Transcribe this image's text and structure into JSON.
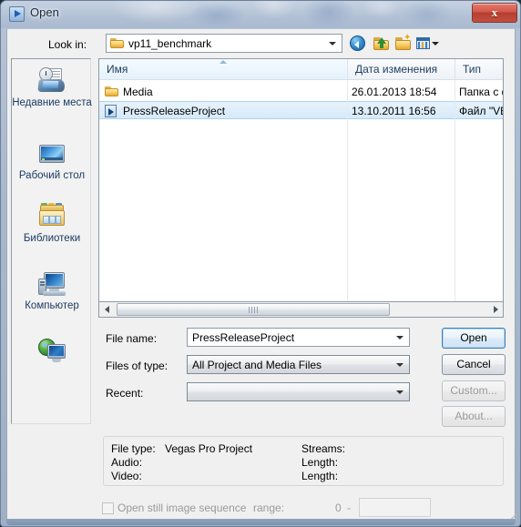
{
  "window": {
    "title": "Open",
    "title_icon": "vegas-play-icon",
    "close_label": "x"
  },
  "toolbar": {
    "lookin_label": "Look in:",
    "lookin_value": "vp11_benchmark",
    "buttons": [
      {
        "name": "back-button",
        "icon": "back-arrow-icon"
      },
      {
        "name": "up-folder-button",
        "icon": "up-folder-icon"
      },
      {
        "name": "new-folder-button",
        "icon": "new-folder-icon"
      },
      {
        "name": "views-button",
        "icon": "views-icon"
      }
    ]
  },
  "places": {
    "items": [
      {
        "label": "Недавние места",
        "icon": "recent-places-icon"
      },
      {
        "label": "Рабочий стол",
        "icon": "desktop-icon"
      },
      {
        "label": "Библиотеки",
        "icon": "libraries-icon"
      },
      {
        "label": "Компьютер",
        "icon": "computer-icon"
      },
      {
        "label": "",
        "icon": "network-icon"
      }
    ]
  },
  "filelist": {
    "columns": [
      "Имя",
      "Дата изменения",
      "Тип"
    ],
    "sort_column": "Имя",
    "rows": [
      {
        "name": "Media",
        "date": "26.01.2013 18:54",
        "type": "Папка с ф",
        "icon": "folder-icon",
        "selected": false
      },
      {
        "name": "PressReleaseProject",
        "date": "13.10.2011 16:56",
        "type": "Файл \"VE",
        "icon": "vegas-project-icon",
        "selected": true
      }
    ]
  },
  "form": {
    "filename_label": "File name:",
    "filename_value": "PressReleaseProject",
    "filetype_label": "Files of type:",
    "filetype_value": "All Project and Media Files",
    "recent_label": "Recent:",
    "recent_value": ""
  },
  "buttons": {
    "open": "Open",
    "cancel": "Cancel",
    "custom": "Custom...",
    "about": "About..."
  },
  "info": {
    "file_type_label": "File type:",
    "file_type_value": "Vegas Pro Project",
    "audio_label": "Audio:",
    "audio_value": "",
    "video_label": "Video:",
    "video_value": "",
    "streams_label": "Streams:",
    "streams_value": "",
    "length1_label": "Length:",
    "length1_value": "",
    "length2_label": "Length:",
    "length2_value": ""
  },
  "sequence": {
    "checkbox_label": "Open still image sequence",
    "range_label": "range:",
    "range_start": "0",
    "range_dash": "-",
    "range_end": ""
  },
  "colors": {
    "accent": "#3c7fb1",
    "selection": "#d6eaf9",
    "title_text": "#1b2a3c",
    "close_button": "#c4503f"
  }
}
